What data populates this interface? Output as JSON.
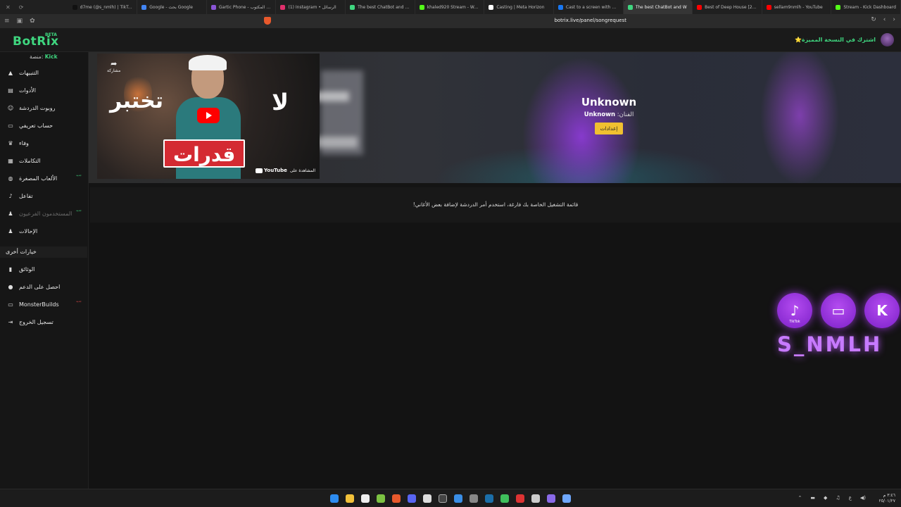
{
  "browser": {
    "tabs": [
      {
        "label": "d7me (@s_nmlh) | TikTok(5)",
        "color": "#111111"
      },
      {
        "label": "Google - بحث Google",
        "color": "#4285f4"
      },
      {
        "label": "Gartic Phone - لعبة المكتوب",
        "color": "#8a55d6"
      },
      {
        "label": "(1) Instagram • الرسائل",
        "color": "#e1306c"
      },
      {
        "label": "The best ChatBot and Wid",
        "color": "#3fd67f"
      },
      {
        "label": "khaled920 Stream - Watch",
        "color": "#53fc18"
      },
      {
        "label": "Casting | Meta Horizon",
        "color": "#ffffff"
      },
      {
        "label": "Cast to a screen with Meta",
        "color": "#1877f2"
      },
      {
        "label": "The best ChatBot and W",
        "color": "#3fd67f",
        "active": true
      },
      {
        "label": "Best of Deep House [2025]",
        "color": "#ff0000"
      },
      {
        "label": "sellam9nmlh - YouTube",
        "color": "#ff0000"
      },
      {
        "label": "Stream - Kick Dashboard",
        "color": "#53fc18"
      }
    ],
    "url": "botrix.live/panel/songrequest"
  },
  "app": {
    "logo": "BotRix",
    "logo_badge": "BETA",
    "premium_label": "اشترك في النسخة المميزة⭐",
    "platform_prefix": "منصة:",
    "platform_name": "Kick"
  },
  "sidebar": {
    "items": [
      {
        "label": "التنبيهات",
        "icon": "warning-icon"
      },
      {
        "label": "الأدوات",
        "icon": "tools-icon"
      },
      {
        "label": "روبوت الدردشة",
        "icon": "robot-icon"
      },
      {
        "label": "حساب تعريفي",
        "icon": "id-card-icon"
      },
      {
        "label": "وفاء",
        "icon": "trophy-icon"
      },
      {
        "label": "التكاملات",
        "icon": "puzzle-icon"
      },
      {
        "label": "الألعاب المصغرة",
        "icon": "gamepad-icon",
        "badge": "جديد"
      },
      {
        "label": "تفاعل",
        "icon": "music-icon"
      },
      {
        "label": "المستخدمون الفرعيون",
        "icon": "users-icon",
        "disabled": true,
        "badge": "جديد"
      },
      {
        "label": "الإحالات",
        "icon": "referral-icon"
      }
    ],
    "other_header": "خيارات أخرى",
    "other_items": [
      {
        "label": "الوثائق",
        "icon": "book-icon"
      },
      {
        "label": "احصل على الدعم",
        "icon": "help-icon"
      },
      {
        "label": "MonsterBuilds",
        "icon": "laptop-icon",
        "badge": "جديد"
      },
      {
        "label": "تسجيل الخروج",
        "icon": "logout-icon"
      }
    ]
  },
  "player": {
    "video_text_left": "تختبر",
    "video_text_right": "لا",
    "video_text_bottom": "قدرات",
    "share_label": "مشاركة",
    "watch_on": "المشاهدة على",
    "youtube": "YouTube",
    "song_title": "Unknown",
    "artist_label": "الفنان:",
    "artist_name": "Unknown",
    "settings_button": "إعدادات"
  },
  "playlist": {
    "empty_message": "قائمة التشغيل الخاصة بك فارغة، استخدم أمر الدردشة لإضافة بعض الأغاني!"
  },
  "overlay": {
    "name": "S_NMLH",
    "tiktok_label": "TikTok",
    "colors": {
      "accent": "#b44cf0",
      "text": "#c77aff"
    }
  },
  "taskbar": {
    "time": "٣:٤٦ م",
    "date": "٢٥/٠١/٢٧",
    "lang": "ع"
  },
  "colors": {
    "brand": "#3fd67f",
    "button": "#f0c030",
    "background": "#141414"
  }
}
